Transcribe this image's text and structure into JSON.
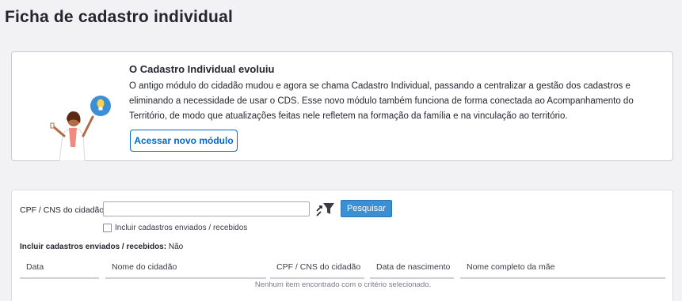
{
  "page": {
    "title": "Ficha de cadastro individual"
  },
  "banner": {
    "title": "O Cadastro Individual evoluiu",
    "text": "O antigo módulo do cidadão mudou e agora se chama Cadastro Individual, passando a centralizar a gestão dos cadastros e eliminando a necessidade de usar o CDS. Esse novo módulo também funciona de forma conectada ao Acompanhamento do Território, de modo que atualizações feitas nele refletem na formação da família e na vinculação ao território.",
    "button_label": "Acessar novo módulo",
    "icon": "lightbulb-icon"
  },
  "search": {
    "label": "CPF / CNS do cidadão",
    "value": "",
    "placeholder": "",
    "filter_icon": "filter-icon",
    "button_label": "Pesquisar",
    "checkbox_label": "Incluir cadastros enviados / recebidos",
    "checkbox_checked": false
  },
  "status": {
    "include_label": "Incluir cadastros enviados / recebidos:",
    "include_value": "Não"
  },
  "table": {
    "columns": [
      "Data",
      "Nome do cidadão",
      "CPF / CNS do cidadão",
      "Data de nascimento",
      "Nome completo da mãe"
    ],
    "rows": [],
    "empty_message": "Nenhum item encontrado com o critério selecionado."
  },
  "colors": {
    "accent": "#0069d0",
    "button": "#3b8fd4",
    "background": "#f2f2f5"
  }
}
